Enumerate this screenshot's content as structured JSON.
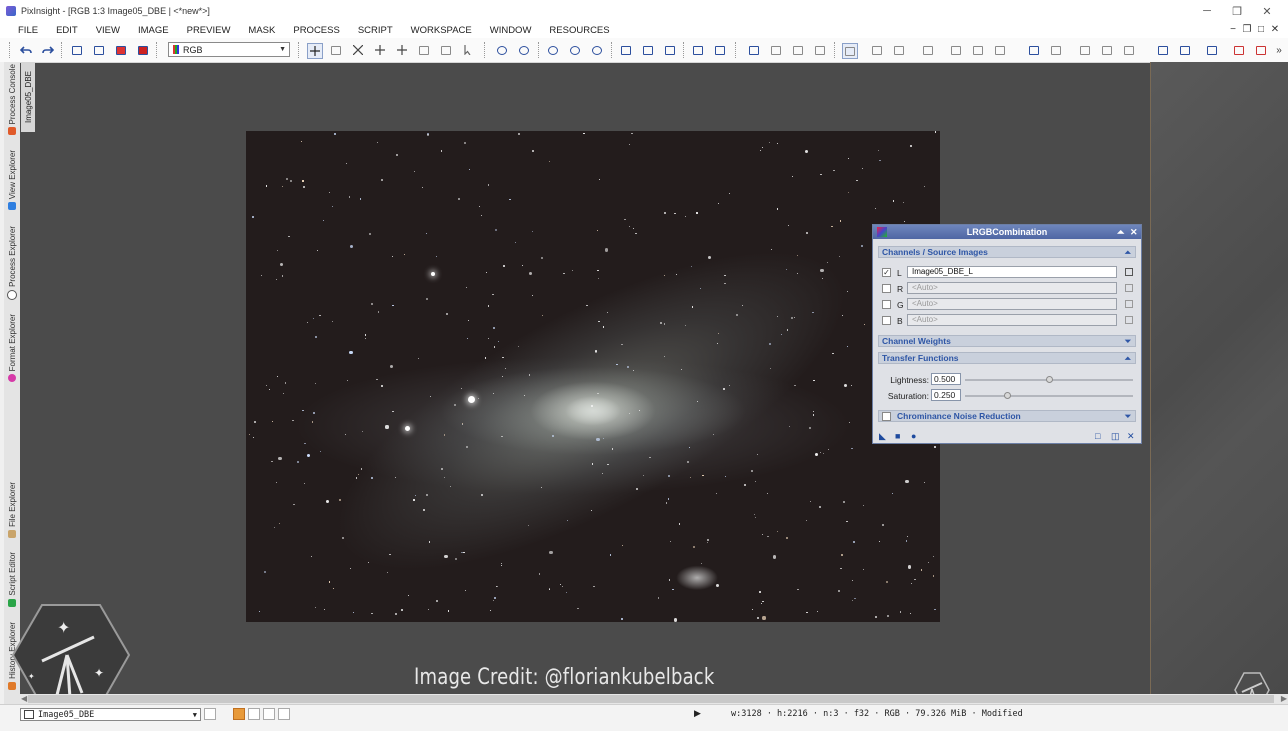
{
  "window": {
    "title": "PixInsight - [RGB 1:3 Image05_DBE | <*new*>]",
    "controls": {
      "minimize": "─",
      "restore": "❒",
      "close": "✕"
    }
  },
  "menu": [
    "FILE",
    "EDIT",
    "VIEW",
    "IMAGE",
    "PREVIEW",
    "MASK",
    "PROCESS",
    "SCRIPT",
    "WORKSPACE",
    "WINDOW",
    "RESOURCES"
  ],
  "mdi_controls": {
    "minimize": "−",
    "restore": "❐",
    "maximize": "□",
    "close": "✕",
    "more": "»"
  },
  "toolbar": {
    "channel_select": "RGB",
    "icons": [
      "undo-icon",
      "redo-icon",
      "new-image-icon",
      "open-icon",
      "save-icon",
      "export-icon",
      "readout-icon",
      "zoom-in-icon",
      "zoom-out-icon",
      "zoom-fit-icon",
      "zoom-100-icon",
      "preview-icon",
      "mask-icon",
      "screen-icon"
    ]
  },
  "side_tabs": [
    {
      "label": "Process Console",
      "icon_color": "#e05a2a"
    },
    {
      "label": "View Explorer",
      "icon_color": "#2f7fe0"
    },
    {
      "label": "Process Explorer",
      "icon_color": "#555555"
    },
    {
      "label": "Format Explorer",
      "icon_color": "#d63aa8"
    },
    {
      "label": "File Explorer",
      "icon_color": "#c9a46a"
    },
    {
      "label": "Script Editor",
      "icon_color": "#2aa548"
    },
    {
      "label": "History Explorer",
      "icon_color": "#e07a2a"
    }
  ],
  "image_tab": "Image05_DBE",
  "credit": "Image Credit: @floriankubelback",
  "panel": {
    "title": "LRGBCombination",
    "sections": {
      "channels": "Channels / Source Images",
      "weights": "Channel Weights",
      "transfer": "Transfer Functions",
      "noise": "Chrominance Noise Reduction"
    },
    "channels": [
      {
        "label": "L",
        "checked": true,
        "value": "Image05_DBE_L"
      },
      {
        "label": "R",
        "checked": false,
        "value": "<Auto>"
      },
      {
        "label": "G",
        "checked": false,
        "value": "<Auto>"
      },
      {
        "label": "B",
        "checked": false,
        "value": "<Auto>"
      }
    ],
    "lightness": {
      "label": "Lightness:",
      "value": "0.500",
      "fraction": 0.5
    },
    "saturation": {
      "label": "Saturation:",
      "value": "0.250",
      "fraction": 0.25
    },
    "noise_checked": false
  },
  "status": {
    "view": "Image05_DBE",
    "info": "w:3128 · h:2216 · n:3 · f32 · RGB · 79.326 MiB · Modified"
  }
}
